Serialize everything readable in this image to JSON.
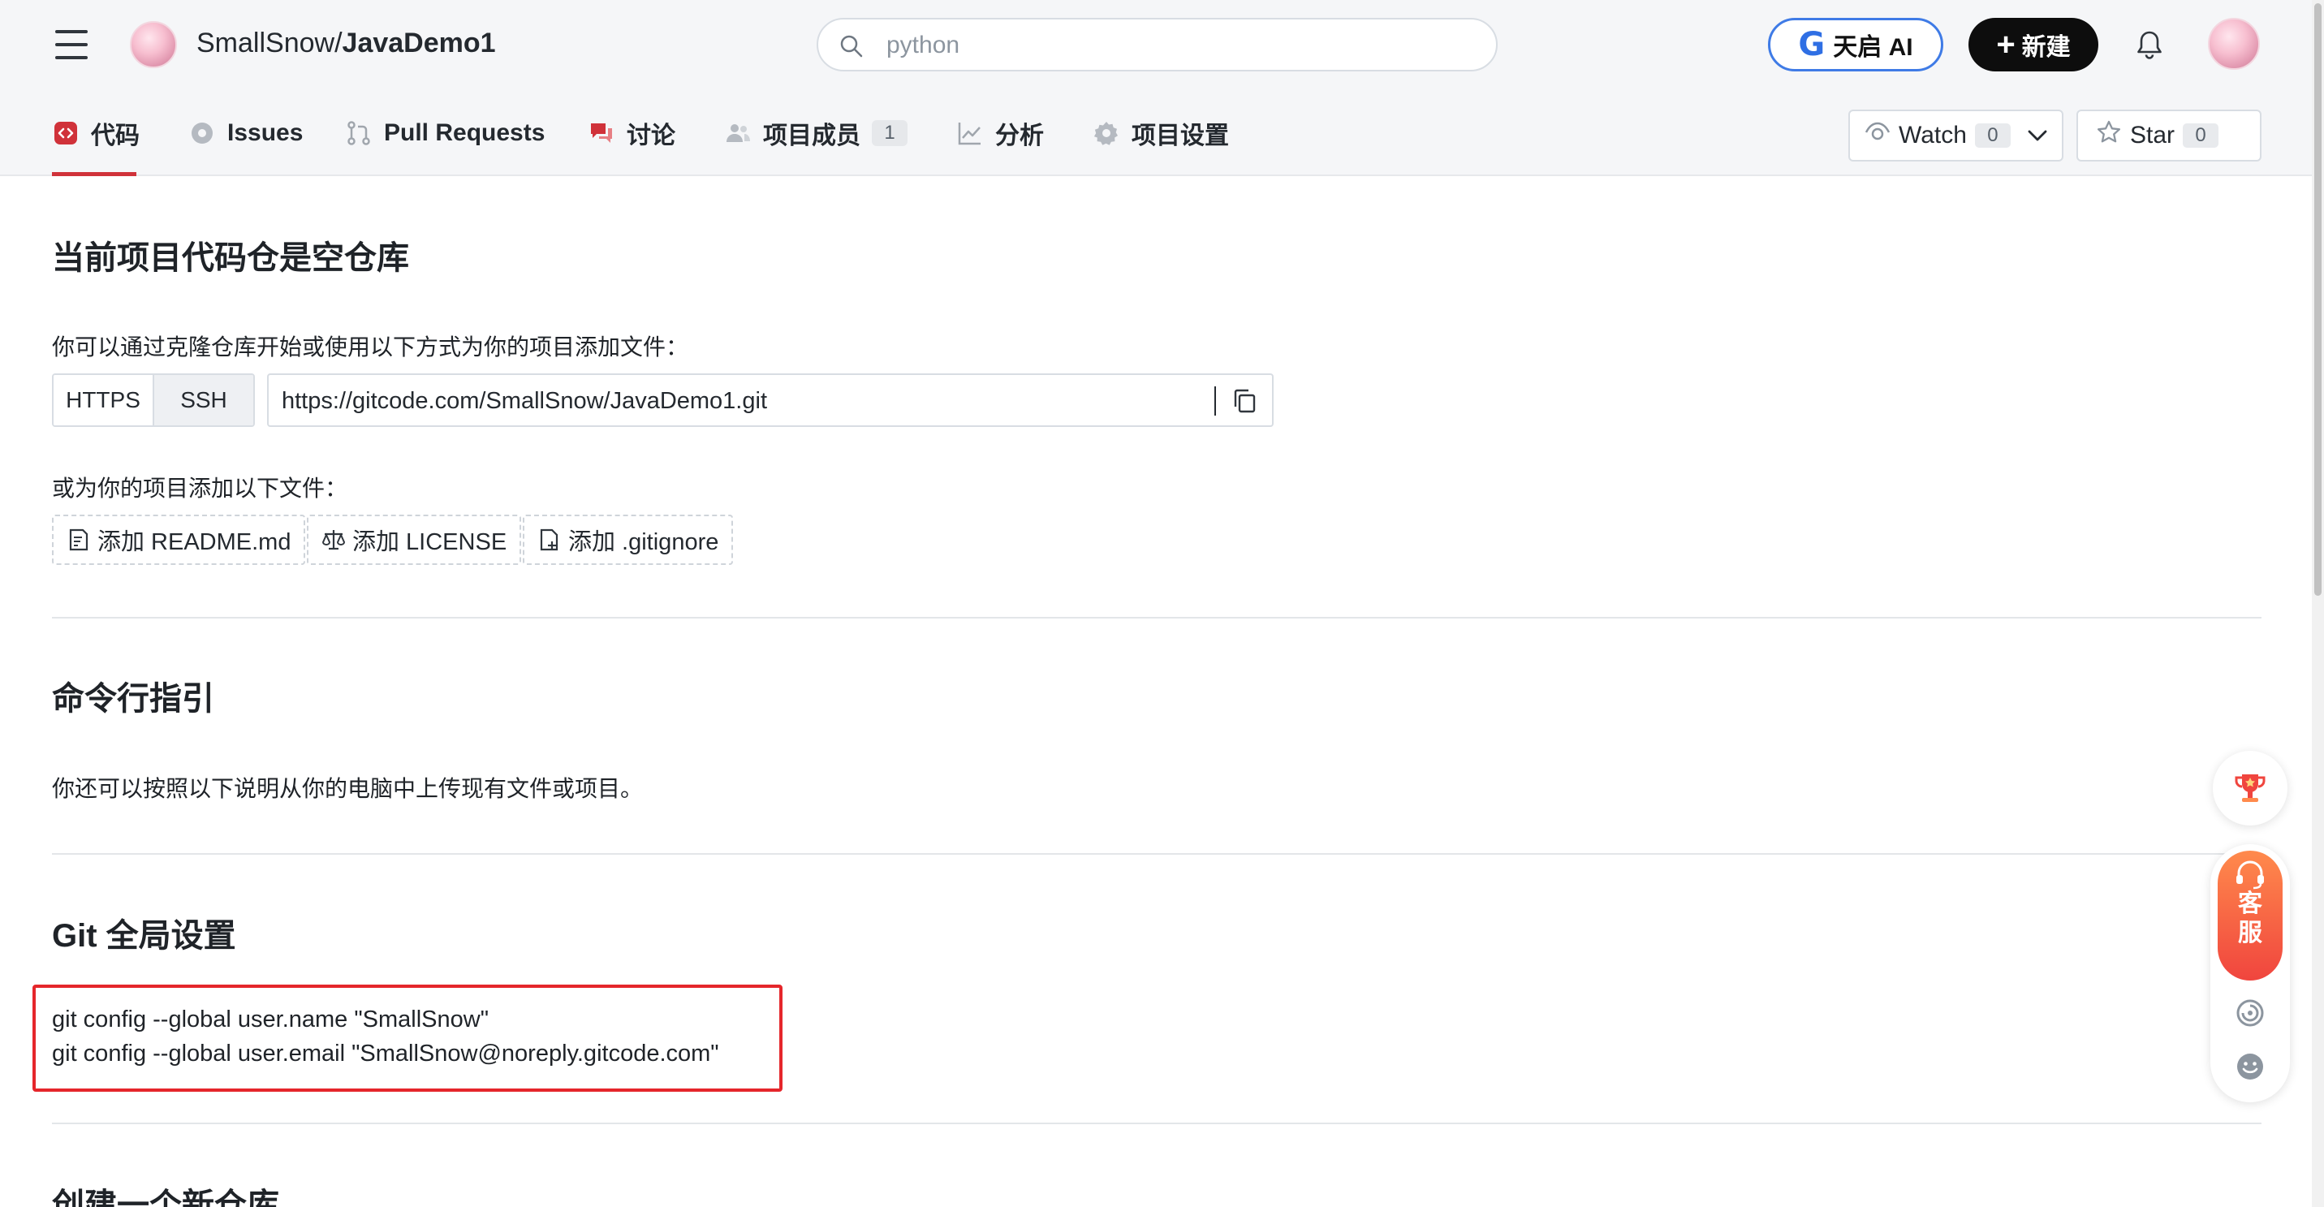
{
  "header": {
    "repo_owner": "SmallSnow",
    "repo_sep": "/",
    "repo_name": "JavaDemo1",
    "search_placeholder": "python",
    "ai_label": "天启 AI",
    "new_label": "新建"
  },
  "tabs": [
    {
      "label": "代码",
      "active": true
    },
    {
      "label": "Issues"
    },
    {
      "label": "Pull Requests"
    },
    {
      "label": "讨论"
    },
    {
      "label": "项目成员",
      "count": "1"
    },
    {
      "label": "分析"
    },
    {
      "label": "项目设置"
    }
  ],
  "watch": {
    "label": "Watch",
    "count": "0"
  },
  "star": {
    "label": "Star",
    "count": "0"
  },
  "empty_repo": {
    "title": "当前项目代码仓是空仓库",
    "clone_hint": "你可以通过克隆仓库开始或使用以下方式为你的项目添加文件：",
    "protocols": [
      "HTTPS",
      "SSH"
    ],
    "clone_url": "https://gitcode.com/SmallSnow/JavaDemo1.git",
    "add_hint": "或为你的项目添加以下文件：",
    "add_readme": "添加 README.md",
    "add_license": "添加 LICENSE",
    "add_gitignore": "添加 .gitignore"
  },
  "cli": {
    "title": "命令行指引",
    "desc": "你还可以按照以下说明从你的电脑中上传现有文件或项目。"
  },
  "git_global": {
    "title": "Git 全局设置",
    "line1": "git config --global user.name \"SmallSnow\"",
    "line2": "git config --global user.email \"SmallSnow@noreply.gitcode.com\""
  },
  "new_repo": {
    "title": "创建一个新仓库"
  },
  "float": {
    "kefu_1": "客",
    "kefu_2": "服"
  },
  "colors": {
    "accent_red": "#d0323a",
    "highlight_box": "#e5262b",
    "ai_blue": "#3f7be6"
  }
}
